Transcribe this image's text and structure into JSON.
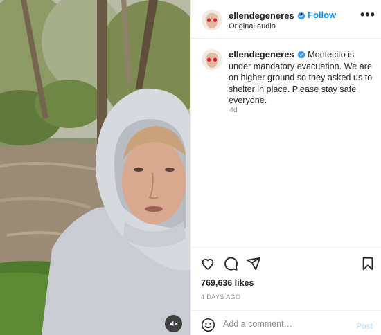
{
  "post": {
    "username": "ellendegeneres",
    "separator": "•",
    "follow_label": "Follow",
    "audio_label": "Original audio",
    "more_label": "•••",
    "caption": "Montecito is under mandatory evacuation. We are on higher ground so they asked us to shelter in place. Please stay safe everyone.",
    "caption_time": "4d",
    "likes": "769,636 likes",
    "posted_date": "4 DAYS AGO"
  },
  "comment": {
    "placeholder": "Add a comment…",
    "post_label": "Post"
  },
  "colors": {
    "accent": "#0095f6",
    "post_disabled": "#b2dffc",
    "verified": "#3897f0",
    "secondary_text": "#8e8e8e"
  },
  "icons": {
    "media_audio": "muted-speaker-icon",
    "like": "heart-icon",
    "comment": "comment-bubble-icon",
    "share": "paper-plane-icon",
    "save": "bookmark-icon",
    "emoji": "smiley-icon",
    "more": "more-options-icon",
    "verified": "verified-badge-icon"
  }
}
